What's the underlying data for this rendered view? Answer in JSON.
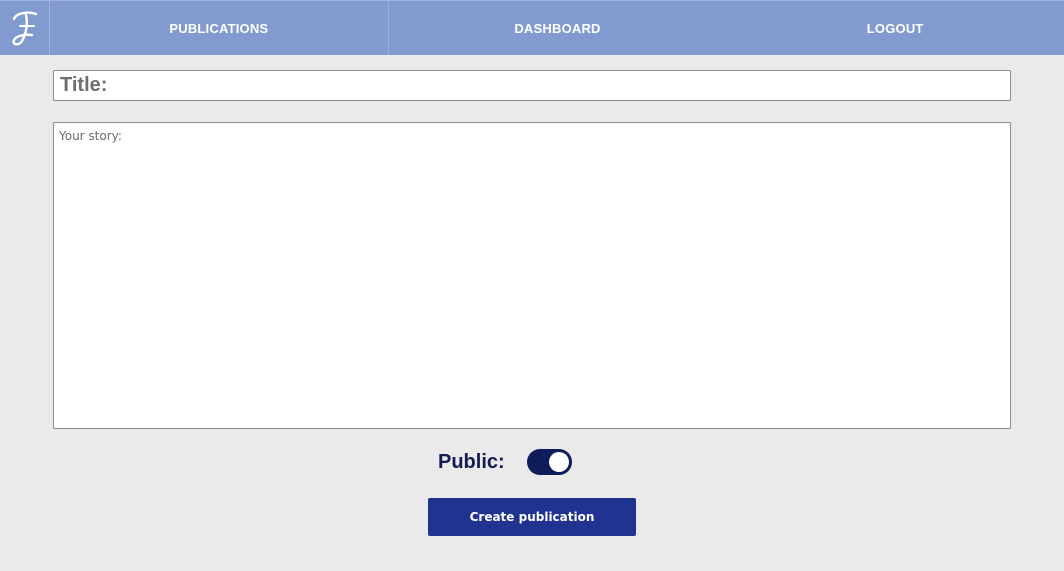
{
  "navbar": {
    "logo_letter": "J",
    "items": [
      {
        "label": "PUBLICATIONS"
      },
      {
        "label": "DASHBOARD"
      },
      {
        "label": "LOGOUT"
      }
    ]
  },
  "form": {
    "title_placeholder": "Title:",
    "title_value": "",
    "story_placeholder": "Your story:",
    "story_value": "",
    "public_label": "Public:",
    "public_enabled": true,
    "submit_label": "Create publication"
  },
  "colors": {
    "navbar_bg": "#819bd0",
    "page_bg": "#eaeaea",
    "toggle_on": "#0e1c5a",
    "button_bg": "#203390",
    "label_text": "#141c52"
  },
  "icons": {
    "logo": "script-j-logo-icon",
    "toggle": "toggle-switch-icon"
  }
}
